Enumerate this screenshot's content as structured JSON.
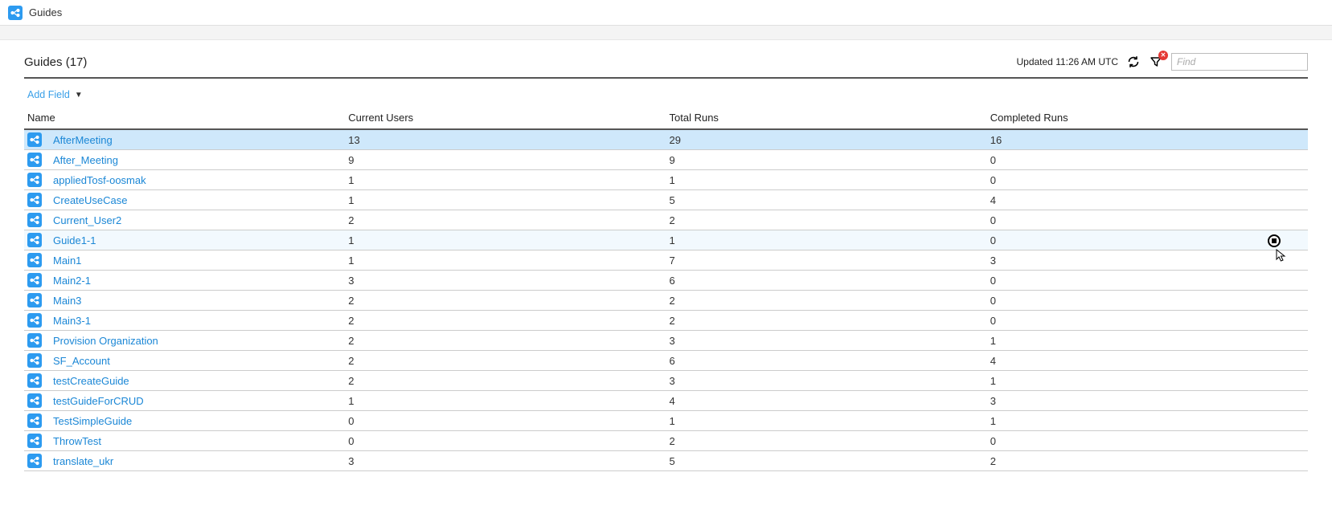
{
  "header": {
    "title": "Guides"
  },
  "list": {
    "title_prefix": "Guides",
    "count_display": "(17)",
    "updated_text": "Updated 11:26 AM UTC",
    "find_placeholder": "Find",
    "add_field_label": "Add Field"
  },
  "columns": {
    "name": "Name",
    "current_users": "Current Users",
    "total_runs": "Total Runs",
    "completed_runs": "Completed Runs"
  },
  "rows": [
    {
      "name": "AfterMeeting",
      "current_users": "13",
      "total_runs": "29",
      "completed_runs": "16",
      "state": "selected"
    },
    {
      "name": "After_Meeting",
      "current_users": "9",
      "total_runs": "9",
      "completed_runs": "0"
    },
    {
      "name": "appliedTosf-oosmak",
      "current_users": "1",
      "total_runs": "1",
      "completed_runs": "0"
    },
    {
      "name": "CreateUseCase",
      "current_users": "1",
      "total_runs": "5",
      "completed_runs": "4"
    },
    {
      "name": "Current_User2",
      "current_users": "2",
      "total_runs": "2",
      "completed_runs": "0"
    },
    {
      "name": "Guide1-1",
      "current_users": "1",
      "total_runs": "1",
      "completed_runs": "0",
      "state": "hovered",
      "show_action": true
    },
    {
      "name": "Main1",
      "current_users": "1",
      "total_runs": "7",
      "completed_runs": "3"
    },
    {
      "name": "Main2-1",
      "current_users": "3",
      "total_runs": "6",
      "completed_runs": "0"
    },
    {
      "name": "Main3",
      "current_users": "2",
      "total_runs": "2",
      "completed_runs": "0"
    },
    {
      "name": "Main3-1",
      "current_users": "2",
      "total_runs": "2",
      "completed_runs": "0"
    },
    {
      "name": "Provision Organization",
      "current_users": "2",
      "total_runs": "3",
      "completed_runs": "1"
    },
    {
      "name": "SF_Account",
      "current_users": "2",
      "total_runs": "6",
      "completed_runs": "4"
    },
    {
      "name": "testCreateGuide",
      "current_users": "2",
      "total_runs": "3",
      "completed_runs": "1"
    },
    {
      "name": "testGuideForCRUD",
      "current_users": "1",
      "total_runs": "4",
      "completed_runs": "3"
    },
    {
      "name": "TestSimpleGuide",
      "current_users": "0",
      "total_runs": "1",
      "completed_runs": "1"
    },
    {
      "name": "ThrowTest",
      "current_users": "0",
      "total_runs": "2",
      "completed_runs": "0"
    },
    {
      "name": "translate_ukr",
      "current_users": "3",
      "total_runs": "5",
      "completed_runs": "2"
    }
  ]
}
